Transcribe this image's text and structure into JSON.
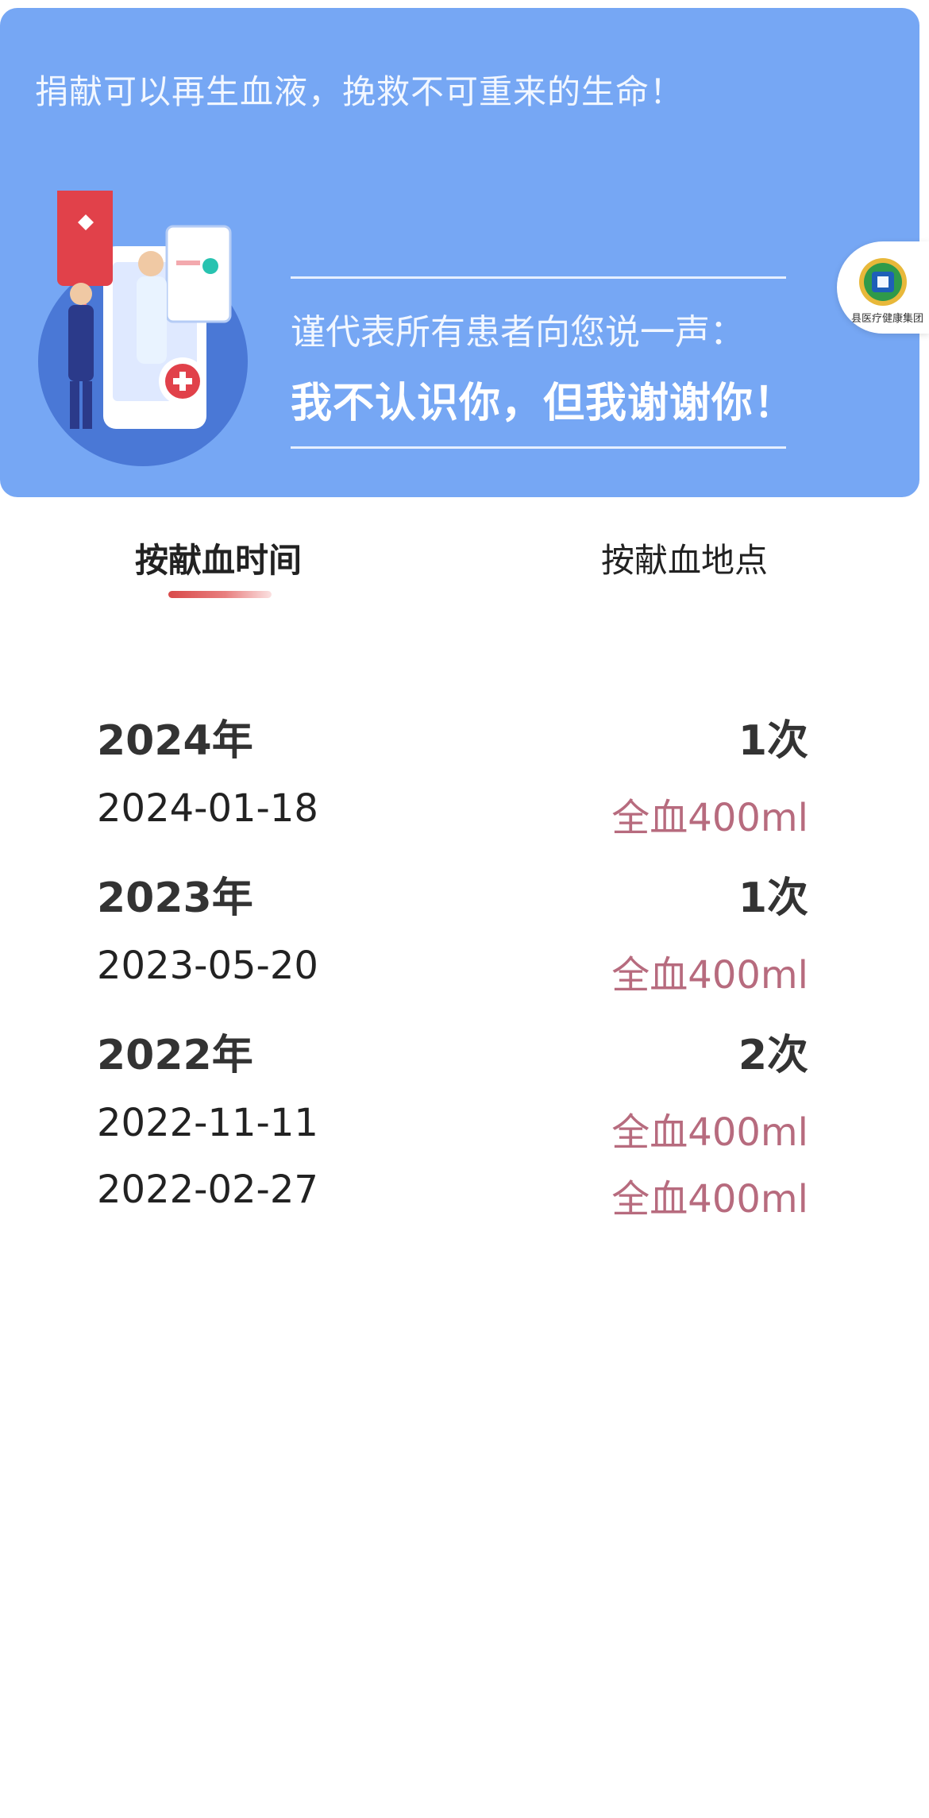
{
  "banner": {
    "slogan": "捐献可以再生血液，挽救不可重来的生命！",
    "thanks_line1": "谨代表所有患者向您说一声：",
    "thanks_line2": "我不认识你，但我谢谢你！",
    "logo_text": "县医疗健康集团",
    "accent": "#76a7f4"
  },
  "tabs": [
    {
      "label": "按献血时间",
      "active": true
    },
    {
      "label": "按献血地点",
      "active": false
    }
  ],
  "records": [
    {
      "year": "2024年",
      "count": "1次",
      "items": [
        {
          "date": "2024-01-18",
          "type": "全血400ml"
        }
      ]
    },
    {
      "year": "2023年",
      "count": "1次",
      "items": [
        {
          "date": "2023-05-20",
          "type": "全血400ml"
        }
      ]
    },
    {
      "year": "2022年",
      "count": "2次",
      "items": [
        {
          "date": "2022-11-11",
          "type": "全血400ml"
        },
        {
          "date": "2022-02-27",
          "type": "全血400ml"
        }
      ]
    }
  ]
}
